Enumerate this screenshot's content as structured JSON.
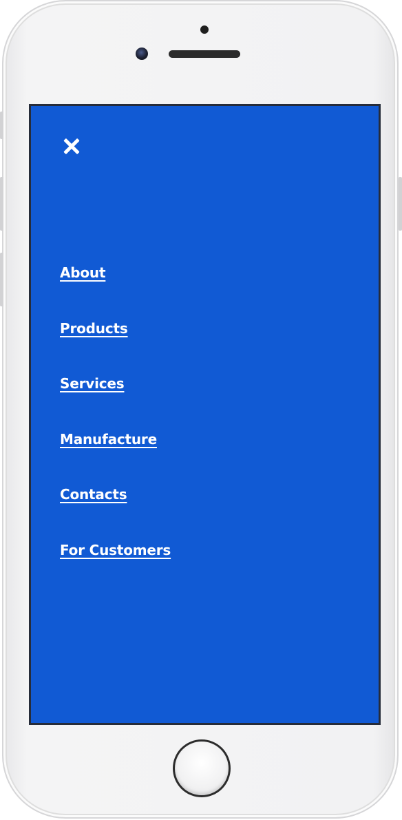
{
  "menu": {
    "items": [
      {
        "label": "About"
      },
      {
        "label": "Products"
      },
      {
        "label": "Services"
      },
      {
        "label": "Manufacture"
      },
      {
        "label": "Contacts"
      },
      {
        "label": "For Customers"
      }
    ]
  },
  "icons": {
    "close": "close-icon"
  },
  "colors": {
    "screen_background": "#115ad4",
    "menu_text": "#ffffff",
    "device_body": "#f2f2f3"
  }
}
